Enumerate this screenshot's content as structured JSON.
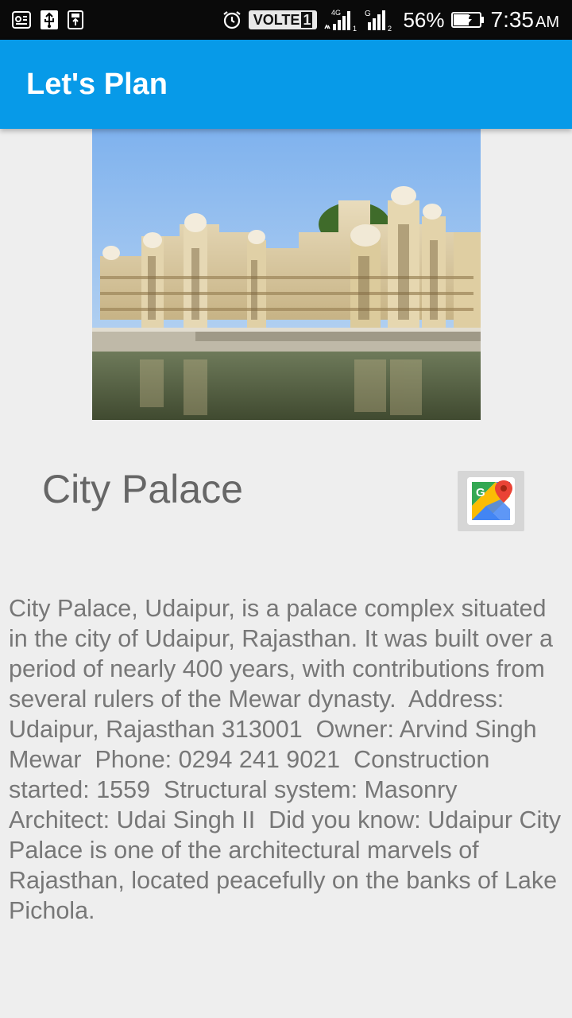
{
  "status_bar": {
    "icons_left": [
      "notification-icon",
      "usb-icon",
      "usb-storage-icon"
    ],
    "alarm_icon": "alarm-icon",
    "volte_label": "VOLTE",
    "volte_sim": "1",
    "network1_label": "4G",
    "network2_label": "G",
    "battery_percent": "56%",
    "time": "7:35",
    "ampm": "AM"
  },
  "app_bar": {
    "title": "Let's Plan"
  },
  "place": {
    "name": "City Palace",
    "maps_button_icon": "google-maps-icon",
    "description": "City Palace, Udaipur, is a palace complex situated in the city of Udaipur, Rajasthan. It was built over a period of nearly 400 years, with contributions from  several rulers of the Mewar dynasty.  Address: Udaipur, Rajasthan 313001  Owner: Arvind Singh Mewar  Phone: 0294 241 9021  Construction started: 1559  Structural system: Masonry  Architect: Udai Singh II  Did you know: Udaipur City Palace is one of the architectural marvels of Rajasthan, located peacefully on the banks of Lake Pichola."
  },
  "colors": {
    "app_bar": "#079ae8",
    "status_bar": "#0a0a0a",
    "background": "#eeeeee",
    "text": "#777777"
  }
}
